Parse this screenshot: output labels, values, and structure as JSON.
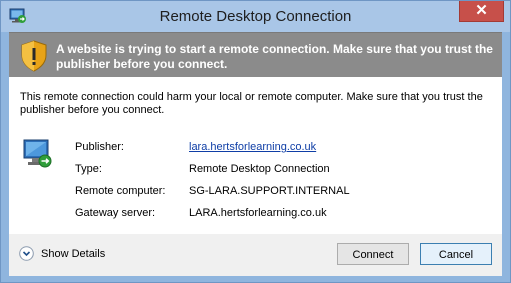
{
  "window": {
    "title": "Remote Desktop Connection",
    "close_label": "✕"
  },
  "banner": {
    "text": "A website is trying to start a remote connection. Make sure that you trust the publisher before you connect."
  },
  "content": {
    "warning": "This remote connection could harm your local or remote computer. Make sure that you trust the publisher before you connect.",
    "details": [
      {
        "label": "Publisher:",
        "value": "lara.hertsforlearning.co.uk",
        "link": true
      },
      {
        "label": "Type:",
        "value": "Remote Desktop Connection",
        "link": false
      },
      {
        "label": "Remote computer:",
        "value": "SG-LARA.SUPPORT.INTERNAL",
        "link": false
      },
      {
        "label": "Gateway server:",
        "value": "LARA.hertsforlearning.co.uk",
        "link": false
      }
    ]
  },
  "footer": {
    "show_details_label": "Show Details",
    "connect_label": "Connect",
    "cancel_label": "Cancel"
  },
  "icons": {
    "app": "remote-desktop-icon",
    "shield": "warning-shield-icon",
    "computer": "remote-computer-icon",
    "chevron": "chevron-down-icon"
  },
  "colors": {
    "titlebar": "#a9c6e7",
    "banner": "#8b8b8b",
    "close": "#c7504a",
    "link": "#0f3ea6"
  }
}
